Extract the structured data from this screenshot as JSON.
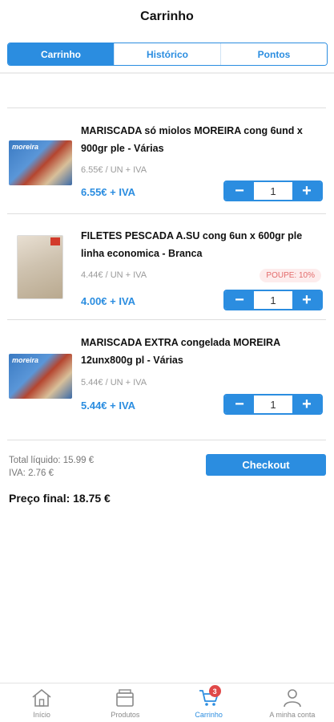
{
  "header": {
    "title": "Carrinho"
  },
  "tabs": [
    {
      "label": "Carrinho",
      "active": true
    },
    {
      "label": "Histórico",
      "active": false
    },
    {
      "label": "Pontos",
      "active": false
    }
  ],
  "cart": {
    "items": [
      {
        "name": "MARISCADA só miolos MOREIRA cong 6und x 900gr ple - Várias",
        "brand": "moreira",
        "unit_price": "6.55€ / UN + IVA",
        "price": "6.55€ + IVA",
        "quantity": "1",
        "badge": ""
      },
      {
        "name": "FILETES PESCADA A.SU cong 6un x 600gr ple linha economica - Branca",
        "brand": "",
        "unit_price": "4.44€ / UN + IVA",
        "price": "4.00€ + IVA",
        "quantity": "1",
        "badge": "POUPE: 10%"
      },
      {
        "name": "MARISCADA EXTRA congelada MOREIRA 12unx800g pl - Várias",
        "brand": "moreira",
        "unit_price": "5.44€ / UN + IVA",
        "price": "5.44€ + IVA",
        "quantity": "1",
        "badge": ""
      }
    ],
    "stepper": {
      "minus": "−",
      "plus": "+"
    }
  },
  "summary": {
    "total_liquido": "Total líquido: 15.99 €",
    "iva": "IVA: 2.76 €",
    "preco_final": "Preço final: 18.75 €",
    "checkout_label": "Checkout"
  },
  "bottom_nav": {
    "items": [
      {
        "label": "Início",
        "icon": "home-icon",
        "active": false
      },
      {
        "label": "Produtos",
        "icon": "box-icon",
        "active": false
      },
      {
        "label": "Carrinho",
        "icon": "cart-icon",
        "active": true,
        "badge": "3"
      },
      {
        "label": "A minha conta",
        "icon": "user-icon",
        "active": false
      }
    ]
  },
  "colors": {
    "accent": "#2b8de0",
    "discount_text": "#e36b6b",
    "discount_bg": "#fdecec",
    "badge": "#e04848"
  }
}
